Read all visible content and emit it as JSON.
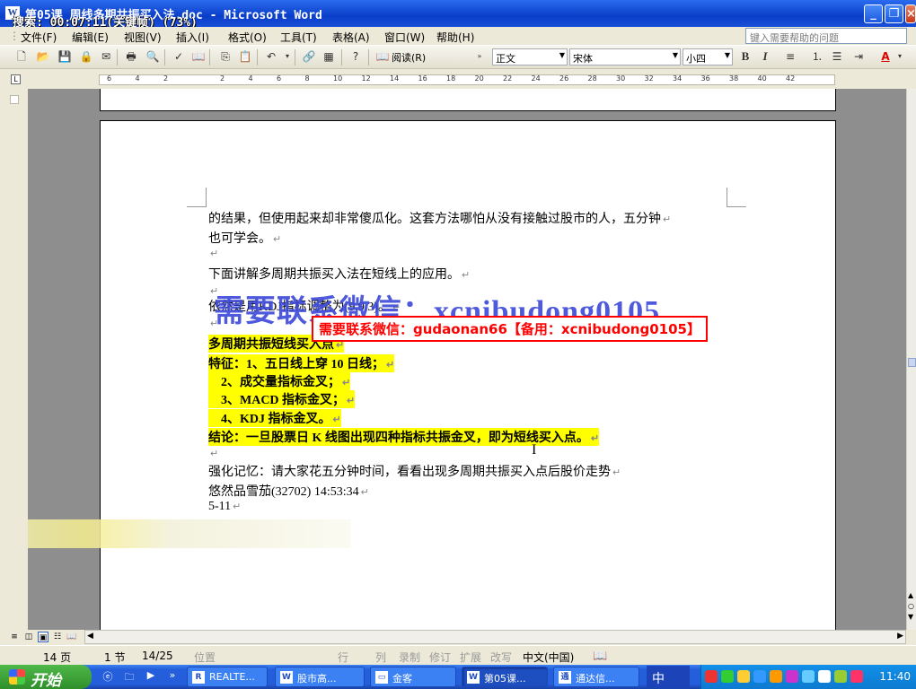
{
  "window": {
    "title": "第05课    周线多期共振买入法.doc - Microsoft Word",
    "recording": "搜索:  00:07:11(关键帧) (73%)"
  },
  "menu": {
    "items": [
      "文件(F)",
      "编辑(E)",
      "视图(V)",
      "插入(I)",
      "格式(O)",
      "工具(T)",
      "表格(A)",
      "窗口(W)",
      "帮助(H)"
    ],
    "help_placeholder": "键入需要帮助的问题"
  },
  "toolbar": {
    "read_label": "阅读(R)",
    "style": "正文",
    "font": "宋体",
    "size": "小四",
    "bold": "B",
    "italic": "I",
    "font_color_label": "A"
  },
  "ruler": {
    "numbers": [
      "6",
      "4",
      "2",
      "",
      "2",
      "4",
      "6",
      "8",
      "10",
      "12",
      "14",
      "16",
      "18",
      "20",
      "22",
      "24",
      "26",
      "28",
      "30",
      "32",
      "34",
      "36",
      "38",
      "40",
      "42"
    ]
  },
  "document": {
    "lines": [
      {
        "text": "的结果，但使用起来却非常傻瓜化。这套方法哪怕从没有接触过股市的人，五分钟",
        "highlight": false
      },
      {
        "text": "也可学会。",
        "highlight": false
      },
      {
        "text": "",
        "highlight": false
      },
      {
        "text": "下面讲解多周期共振买入法在短线上的应用。",
        "highlight": false
      },
      {
        "text": "",
        "highlight": false
      },
      {
        "text": "依然是用KDJ指标调整为(9,9,3)。",
        "highlight": false
      },
      {
        "text": "",
        "highlight": false
      },
      {
        "text": "多周期共振短线买入点",
        "highlight": true
      },
      {
        "text": "特征：1、五日线上穿 10 日线；",
        "highlight": true
      },
      {
        "text": "    2、成交量指标金叉；",
        "highlight": true
      },
      {
        "text": "    3、MACD 指标金叉；",
        "highlight": true
      },
      {
        "text": "    4、KDJ 指标金叉。",
        "highlight": true
      },
      {
        "text": "结论：一旦股票日 K 线图出现四种指标共振金叉，即为短线买入点。",
        "highlight": true
      },
      {
        "text": "",
        "highlight": false
      },
      {
        "text": "强化记忆：请大家花五分钟时间，看看出现多周期共振买入点后股价走势",
        "highlight": false
      },
      {
        "text": "悠然品雪茄(32702) 14:53:34",
        "highlight": false
      },
      {
        "text": "5-11",
        "highlight": false
      }
    ],
    "watermark_large": "需要联系微信：xcnibudong0105",
    "watermark_box": "需要联系微信：gudaonan66【备用：xcnibudong0105】",
    "cursor": "I"
  },
  "status": {
    "page": "14 页",
    "section": "1 节",
    "page_of": "14/25",
    "position": "位置",
    "line": "行",
    "col": "列",
    "rec": "录制",
    "trk": "修订",
    "ext": "扩展",
    "ovr": "改写",
    "lang": "中文(中国)"
  },
  "taskbar": {
    "start": "开始",
    "tasks": [
      "REALTE...",
      "股市高...",
      "金客",
      "第05课...",
      "通达信..."
    ],
    "ime": "中",
    "clock": "11:40"
  }
}
